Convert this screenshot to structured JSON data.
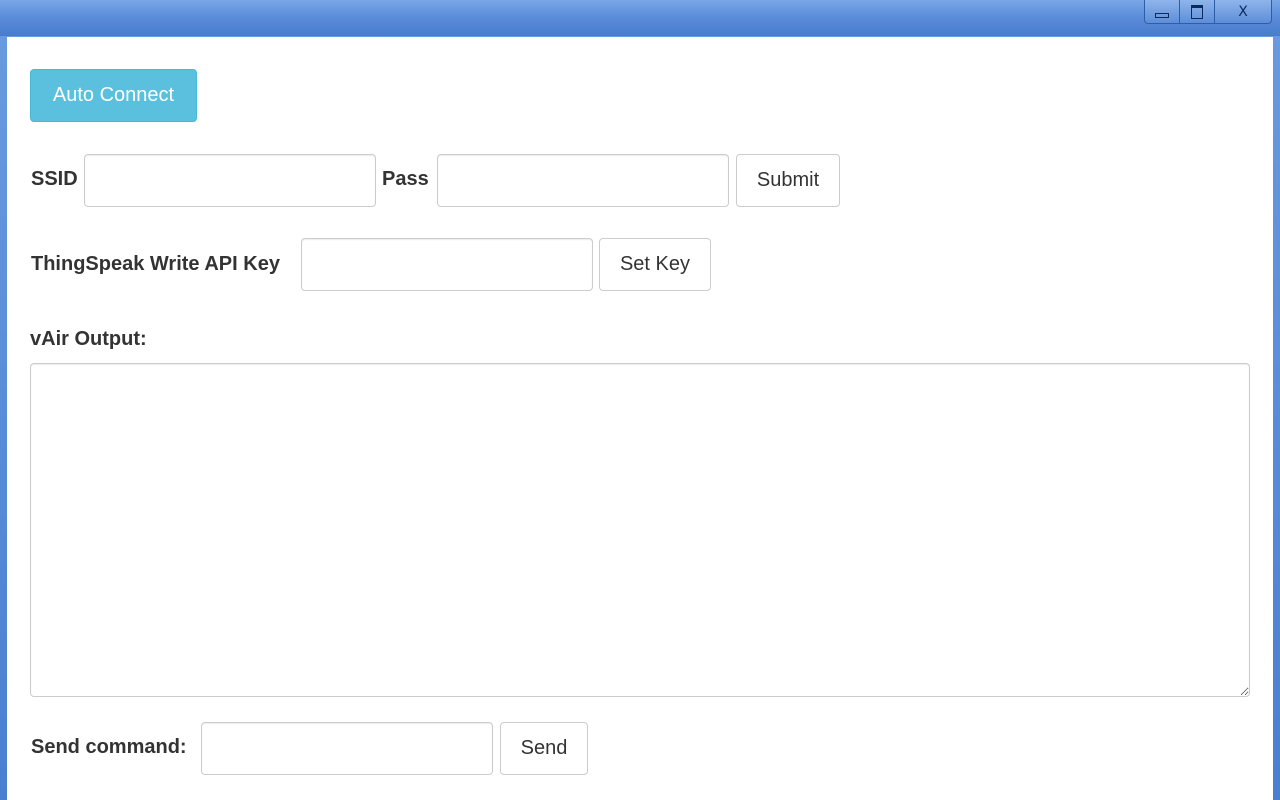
{
  "window": {
    "controls": {
      "minimize": "minimize-icon",
      "maximize": "maximize-icon",
      "close": "X"
    }
  },
  "auto_connect": {
    "label": "Auto Connect"
  },
  "wifi": {
    "ssid_label": "SSID",
    "ssid_value": "",
    "pass_label": "Pass",
    "pass_value": "",
    "submit_label": "Submit"
  },
  "thingspeak": {
    "label": "ThingSpeak Write API Key",
    "key_value": "",
    "set_key_label": "Set Key"
  },
  "output": {
    "label": "vAir Output:",
    "value": ""
  },
  "command": {
    "label": "Send command:",
    "value": "",
    "send_label": "Send"
  },
  "colors": {
    "accent": "#5bc0de",
    "titlebar": "#5b8ddb"
  }
}
